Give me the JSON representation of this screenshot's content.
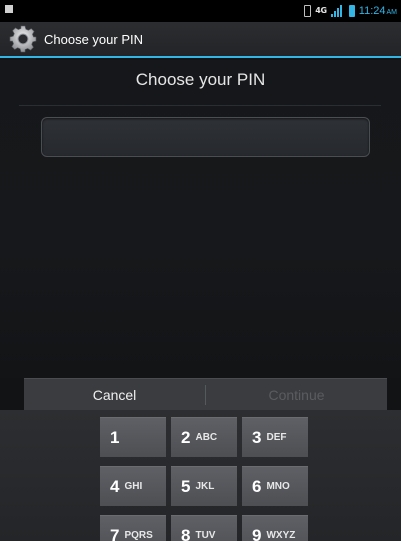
{
  "status_bar": {
    "network": "4G",
    "time": "11:24",
    "ampm": "AM",
    "accent_color": "#33b5e5"
  },
  "action_bar": {
    "icon": "gear-icon",
    "title": "Choose your PIN"
  },
  "content": {
    "header": "Choose your PIN",
    "pin_field": {
      "value": "",
      "placeholder": ""
    }
  },
  "buttons": {
    "cancel_label": "Cancel",
    "continue_label": "Continue"
  },
  "keypad": {
    "keys": [
      {
        "num": "1",
        "letters": ""
      },
      {
        "num": "2",
        "letters": "ABC"
      },
      {
        "num": "3",
        "letters": "DEF"
      },
      {
        "num": "4",
        "letters": "GHI"
      },
      {
        "num": "5",
        "letters": "JKL"
      },
      {
        "num": "6",
        "letters": "MNO"
      },
      {
        "num": "7",
        "letters": "PQRS"
      },
      {
        "num": "8",
        "letters": "TUV"
      },
      {
        "num": "9",
        "letters": "WXYZ"
      }
    ]
  }
}
